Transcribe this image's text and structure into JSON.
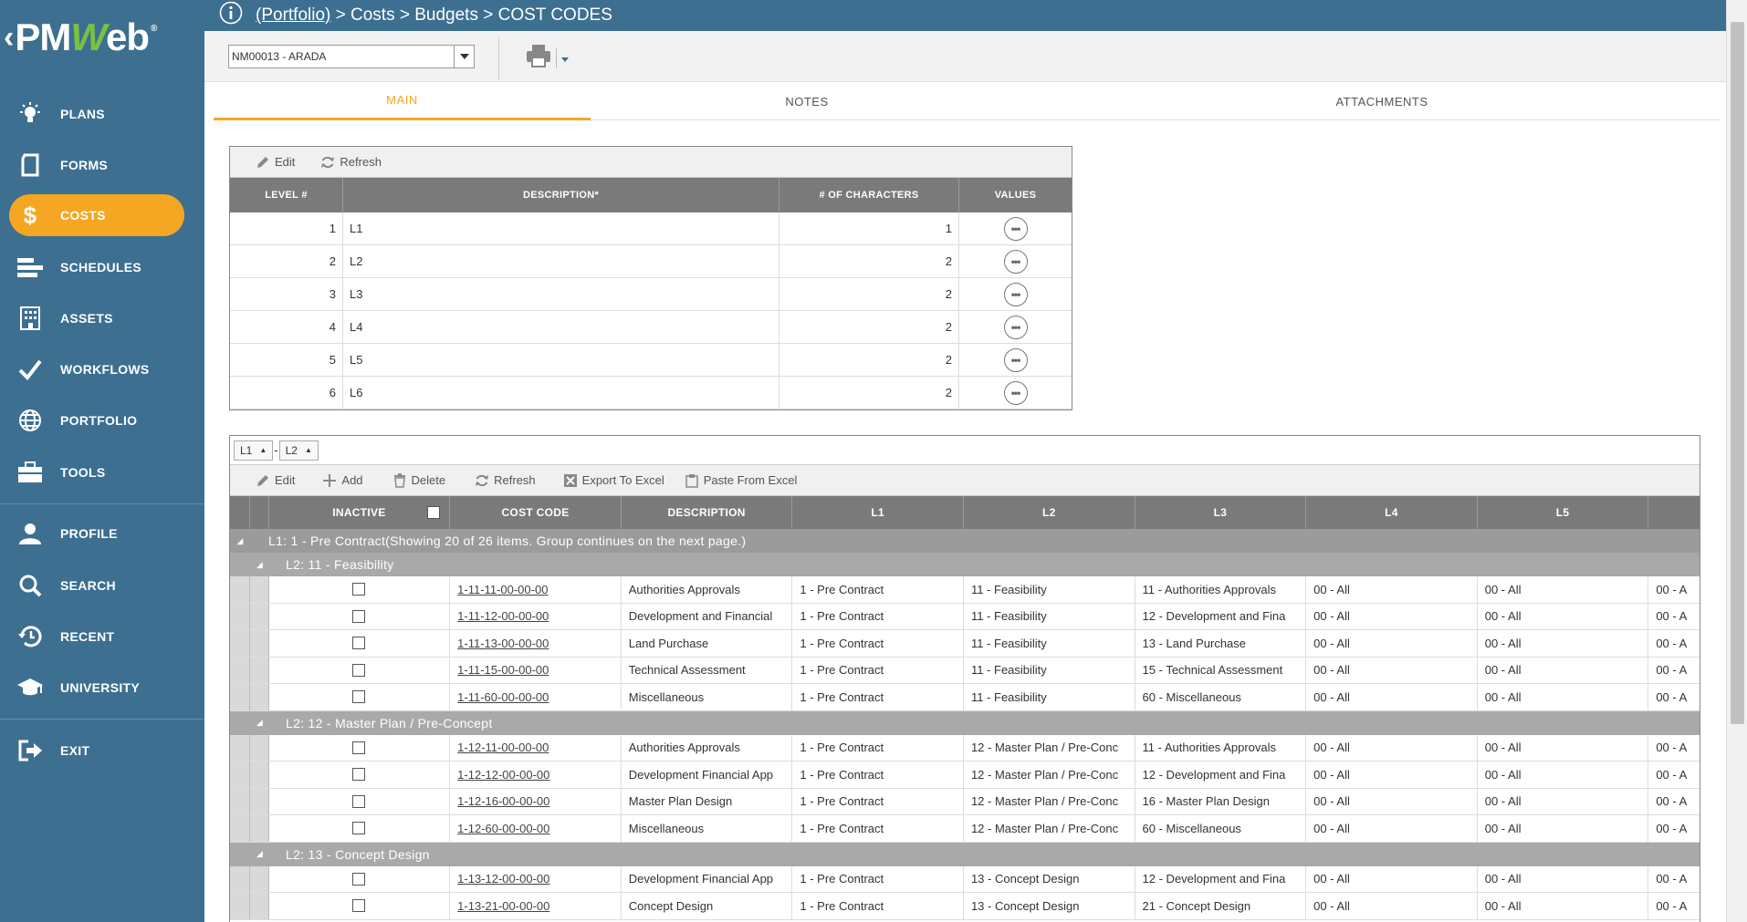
{
  "sidebar": {
    "logo": {
      "prefix": "PM",
      "w": "W",
      "suffix": "eb",
      "reg": "®"
    },
    "items": [
      {
        "label": "PLANS",
        "icon": "lightbulb-icon"
      },
      {
        "label": "FORMS",
        "icon": "document-icon"
      },
      {
        "label": "COSTS",
        "icon": "dollar-icon",
        "active": true
      },
      {
        "label": "SCHEDULES",
        "icon": "bars-icon"
      },
      {
        "label": "ASSETS",
        "icon": "building-icon"
      },
      {
        "label": "WORKFLOWS",
        "icon": "checkmark-icon"
      },
      {
        "label": "PORTFOLIO",
        "icon": "globe-icon"
      },
      {
        "label": "TOOLS",
        "icon": "briefcase-icon"
      },
      {
        "label": "PROFILE",
        "icon": "user-icon"
      },
      {
        "label": "SEARCH",
        "icon": "search-icon"
      },
      {
        "label": "RECENT",
        "icon": "history-icon"
      },
      {
        "label": "UNIVERSITY",
        "icon": "graduation-cap-icon"
      },
      {
        "label": "EXIT",
        "icon": "exit-icon"
      }
    ]
  },
  "breadcrumb": {
    "portfolio": "(Portfolio)",
    "rest": " > Costs > Budgets > COST CODES"
  },
  "toolbar": {
    "project": "NM00013 - ARADA"
  },
  "tabs": [
    "MAIN",
    "NOTES",
    "ATTACHMENTS"
  ],
  "levels_grid": {
    "toolbar": {
      "edit": "Edit",
      "refresh": "Refresh"
    },
    "columns": [
      "LEVEL #",
      "DESCRIPTION*",
      "# OF CHARACTERS",
      "VALUES"
    ],
    "rows": [
      {
        "level": "1",
        "description": "L1",
        "chars": "1"
      },
      {
        "level": "2",
        "description": "L2",
        "chars": "2"
      },
      {
        "level": "3",
        "description": "L3",
        "chars": "2"
      },
      {
        "level": "4",
        "description": "L4",
        "chars": "2"
      },
      {
        "level": "5",
        "description": "L5",
        "chars": "2"
      },
      {
        "level": "6",
        "description": "L6",
        "chars": "2"
      }
    ]
  },
  "codes_grid": {
    "group_by": {
      "first": "L1",
      "sep": "-",
      "second": "L2"
    },
    "toolbar": {
      "edit": "Edit",
      "add": "Add",
      "delete": "Delete",
      "refresh": "Refresh",
      "export": "Export To Excel",
      "paste": "Paste From Excel"
    },
    "columns": [
      "INACTIVE",
      "COST CODE",
      "DESCRIPTION",
      "L1",
      "L2",
      "L3",
      "L4",
      "L5"
    ],
    "l1_group": "L1: 1 - Pre Contract(Showing 20 of 26 items. Group continues on the next page.)",
    "groups": [
      {
        "label": "L2: 11 - Feasibility",
        "rows": [
          {
            "code": "1-11-11-00-00-00",
            "desc": "Authorities Approvals",
            "l1": "1 - Pre Contract",
            "l2": "11 - Feasibility",
            "l3": "11 - Authorities Approvals",
            "l4": "00 - All",
            "l5": "00 - All",
            "l6": "00 - A"
          },
          {
            "code": "1-11-12-00-00-00",
            "desc": "Development and Financial",
            "l1": "1 - Pre Contract",
            "l2": "11 - Feasibility",
            "l3": "12 - Development and Fina",
            "l4": "00 - All",
            "l5": "00 - All",
            "l6": "00 - A"
          },
          {
            "code": "1-11-13-00-00-00",
            "desc": "Land Purchase",
            "l1": "1 - Pre Contract",
            "l2": "11 - Feasibility",
            "l3": "13 - Land Purchase",
            "l4": "00 - All",
            "l5": "00 - All",
            "l6": "00 - A"
          },
          {
            "code": "1-11-15-00-00-00",
            "desc": "Technical Assessment",
            "l1": "1 - Pre Contract",
            "l2": "11 - Feasibility",
            "l3": "15 - Technical Assessment",
            "l4": "00 - All",
            "l5": "00 - All",
            "l6": "00 - A"
          },
          {
            "code": "1-11-60-00-00-00",
            "desc": "Miscellaneous",
            "l1": "1 - Pre Contract",
            "l2": "11 - Feasibility",
            "l3": "60 - Miscellaneous",
            "l4": "00 - All",
            "l5": "00 - All",
            "l6": "00 - A"
          }
        ]
      },
      {
        "label": "L2: 12 - Master Plan / Pre-Concept",
        "rows": [
          {
            "code": "1-12-11-00-00-00",
            "desc": "Authorities Approvals",
            "l1": "1 - Pre Contract",
            "l2": "12 - Master Plan / Pre-Conc",
            "l3": "11 - Authorities Approvals",
            "l4": "00 - All",
            "l5": "00 - All",
            "l6": "00 - A"
          },
          {
            "code": "1-12-12-00-00-00",
            "desc": "Development Financial App",
            "l1": "1 - Pre Contract",
            "l2": "12 - Master Plan / Pre-Conc",
            "l3": "12 - Development and Fina",
            "l4": "00 - All",
            "l5": "00 - All",
            "l6": "00 - A"
          },
          {
            "code": "1-12-16-00-00-00",
            "desc": "Master Plan Design",
            "l1": "1 - Pre Contract",
            "l2": "12 - Master Plan / Pre-Conc",
            "l3": "16 - Master Plan Design",
            "l4": "00 - All",
            "l5": "00 - All",
            "l6": "00 - A"
          },
          {
            "code": "1-12-60-00-00-00",
            "desc": "Miscellaneous",
            "l1": "1 - Pre Contract",
            "l2": "12 - Master Plan / Pre-Conc",
            "l3": "60 - Miscellaneous",
            "l4": "00 - All",
            "l5": "00 - All",
            "l6": "00 - A"
          }
        ]
      },
      {
        "label": "L2: 13 - Concept Design",
        "rows": [
          {
            "code": "1-13-12-00-00-00",
            "desc": "Development Financial App",
            "l1": "1 - Pre Contract",
            "l2": "13 - Concept Design",
            "l3": "12 - Development and Fina",
            "l4": "00 - All",
            "l5": "00 - All",
            "l6": "00 - A"
          },
          {
            "code": "1-13-21-00-00-00",
            "desc": "Concept Design",
            "l1": "1 - Pre Contract",
            "l2": "13 - Concept Design",
            "l3": "21 - Concept Design",
            "l4": "00 - All",
            "l5": "00 - All",
            "l6": "00 - A"
          }
        ]
      }
    ]
  },
  "colors": {
    "sidebar": "#3d6f91",
    "accent": "#f5a623",
    "header_gray": "#7a7a7a"
  }
}
